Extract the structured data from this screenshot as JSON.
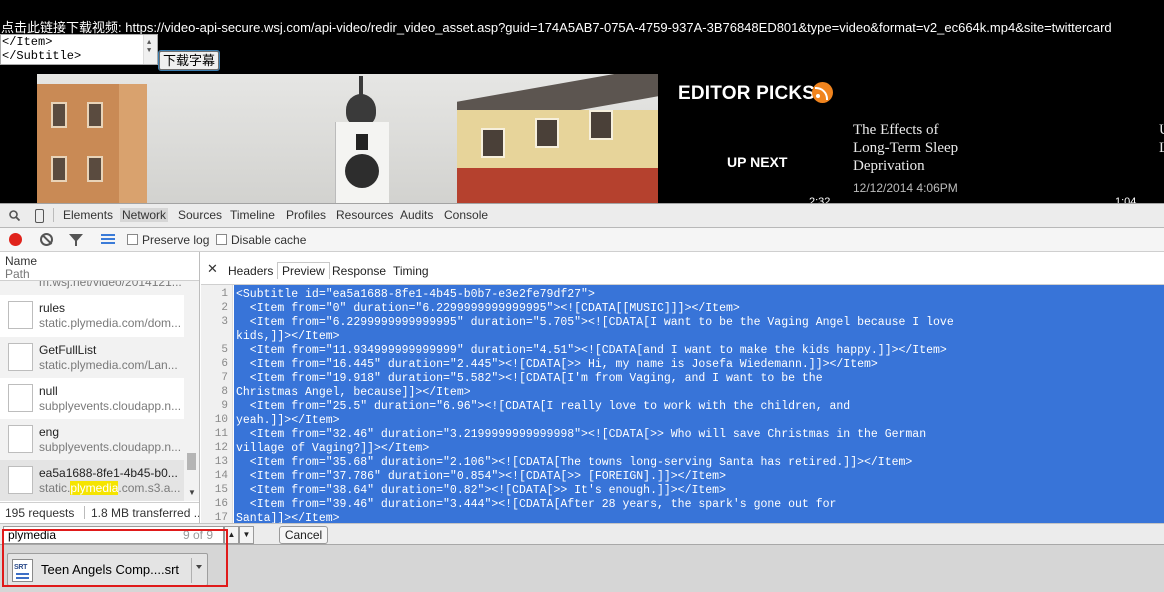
{
  "page": {
    "url_line": "点击此链接下载视频: https://video-api-secure.wsj.com/api-video/redir_video_asset.asp?guid=174A5AB7-075A-4759-937A-3B76848ED801&type=video&format=v2_ec664k.mp4&site=twittercard",
    "textarea_lines": [
      "</Item>",
      "</Subtitle>"
    ],
    "download_subtitle_button": "下载字幕",
    "editor_picks": "EDITOR PICKS",
    "up_next": "UP NEXT",
    "pick": {
      "title_lines": [
        "The Effects of",
        "Long-Term Sleep",
        "Deprivation"
      ],
      "date": "12/12/2014 4:06PM",
      "duration": "2:32"
    },
    "next_duration": "1:04",
    "next_title_clip": "U\nL"
  },
  "devtools": {
    "tabs": [
      "Elements",
      "Network",
      "Sources",
      "Timeline",
      "Profiles",
      "Resources",
      "Audits",
      "Console"
    ],
    "active_tab": "Network",
    "toolbar": {
      "preserve_log": "Preserve log",
      "disable_cache": "Disable cache"
    },
    "request_header": {
      "name": "Name",
      "path": "Path"
    },
    "requests": [
      {
        "name": "",
        "domain": "m.wsj.net/video/2014121..."
      },
      {
        "name": "rules",
        "domain": "static.plymedia.com/dom..."
      },
      {
        "name": "GetFullList",
        "domain": "static.plymedia.com/Lan..."
      },
      {
        "name": "null",
        "domain": "subplyevents.cloudapp.n..."
      },
      {
        "name": "eng",
        "domain": "subplyevents.cloudapp.n..."
      },
      {
        "name": "ea5a1688-8fe1-4b45-b0...",
        "domain_pre": "static.",
        "domain_hl": "plymedia",
        "domain_post": ".com.s3.a..."
      }
    ],
    "status": {
      "requests": "195 requests",
      "transferred": "1.8 MB transferred ..."
    },
    "detail_tabs": [
      "Headers",
      "Preview",
      "Response",
      "Timing"
    ],
    "active_detail_tab": "Preview",
    "code_lines": [
      "<Subtitle id=\"ea5a1688-8fe1-4b45-b0b7-e3e2fe79df27\">",
      "  <Item from=\"0\" duration=\"6.2299999999999995\"><![CDATA[[MUSIC]]]></Item>",
      "  <Item from=\"6.2299999999999995\" duration=\"5.705\"><![CDATA[I want to be the Vaging Angel because I love",
      "kids,]]></Item>",
      "  <Item from=\"11.934999999999999\" duration=\"4.51\"><![CDATA[and I want to make the kids happy.]]></Item>",
      "  <Item from=\"16.445\" duration=\"2.445\"><![CDATA[>> Hi, my name is Josefa Wiedemann.]]></Item>",
      "  <Item from=\"19.918\" duration=\"5.582\"><![CDATA[I'm from Vaging, and I want to be the",
      "Christmas Angel, because]]></Item>",
      "  <Item from=\"25.5\" duration=\"6.96\"><![CDATA[I really love to work with the children, and",
      "yeah.]]></Item>",
      "  <Item from=\"32.46\" duration=\"3.2199999999999998\"><![CDATA[>> Who will save Christmas in the German",
      "village of Vaging?]]></Item>",
      "  <Item from=\"35.68\" duration=\"2.106\"><![CDATA[The towns long-serving Santa has retired.]]></Item>",
      "  <Item from=\"37.786\" duration=\"0.854\"><![CDATA[>> [FOREIGN].]]></Item>",
      "  <Item from=\"38.64\" duration=\"0.82\"><![CDATA[>> It's enough.]]></Item>",
      "  <Item from=\"39.46\" duration=\"3.444\"><![CDATA[After 28 years, the spark's gone out for",
      "Santa]]></Item>"
    ],
    "gutter_numbers": [
      "1",
      "2",
      "3",
      "",
      "5",
      "6",
      "7",
      "8",
      "9",
      "10",
      "11",
      "12",
      "13",
      "14",
      "15",
      "16",
      "17"
    ],
    "find": {
      "query": "plymedia",
      "count": "9 of 9",
      "cancel": "Cancel"
    }
  },
  "download_shelf": {
    "item_name": "Teen Angels Comp....srt",
    "icon_tag": "SRT"
  },
  "colors": {
    "selection_blue": "#3874d8",
    "record_red": "#e0231b",
    "rss_orange": "#f0841e",
    "annotation_red": "#e01a1a",
    "highlight_yellow": "#f5e400"
  }
}
